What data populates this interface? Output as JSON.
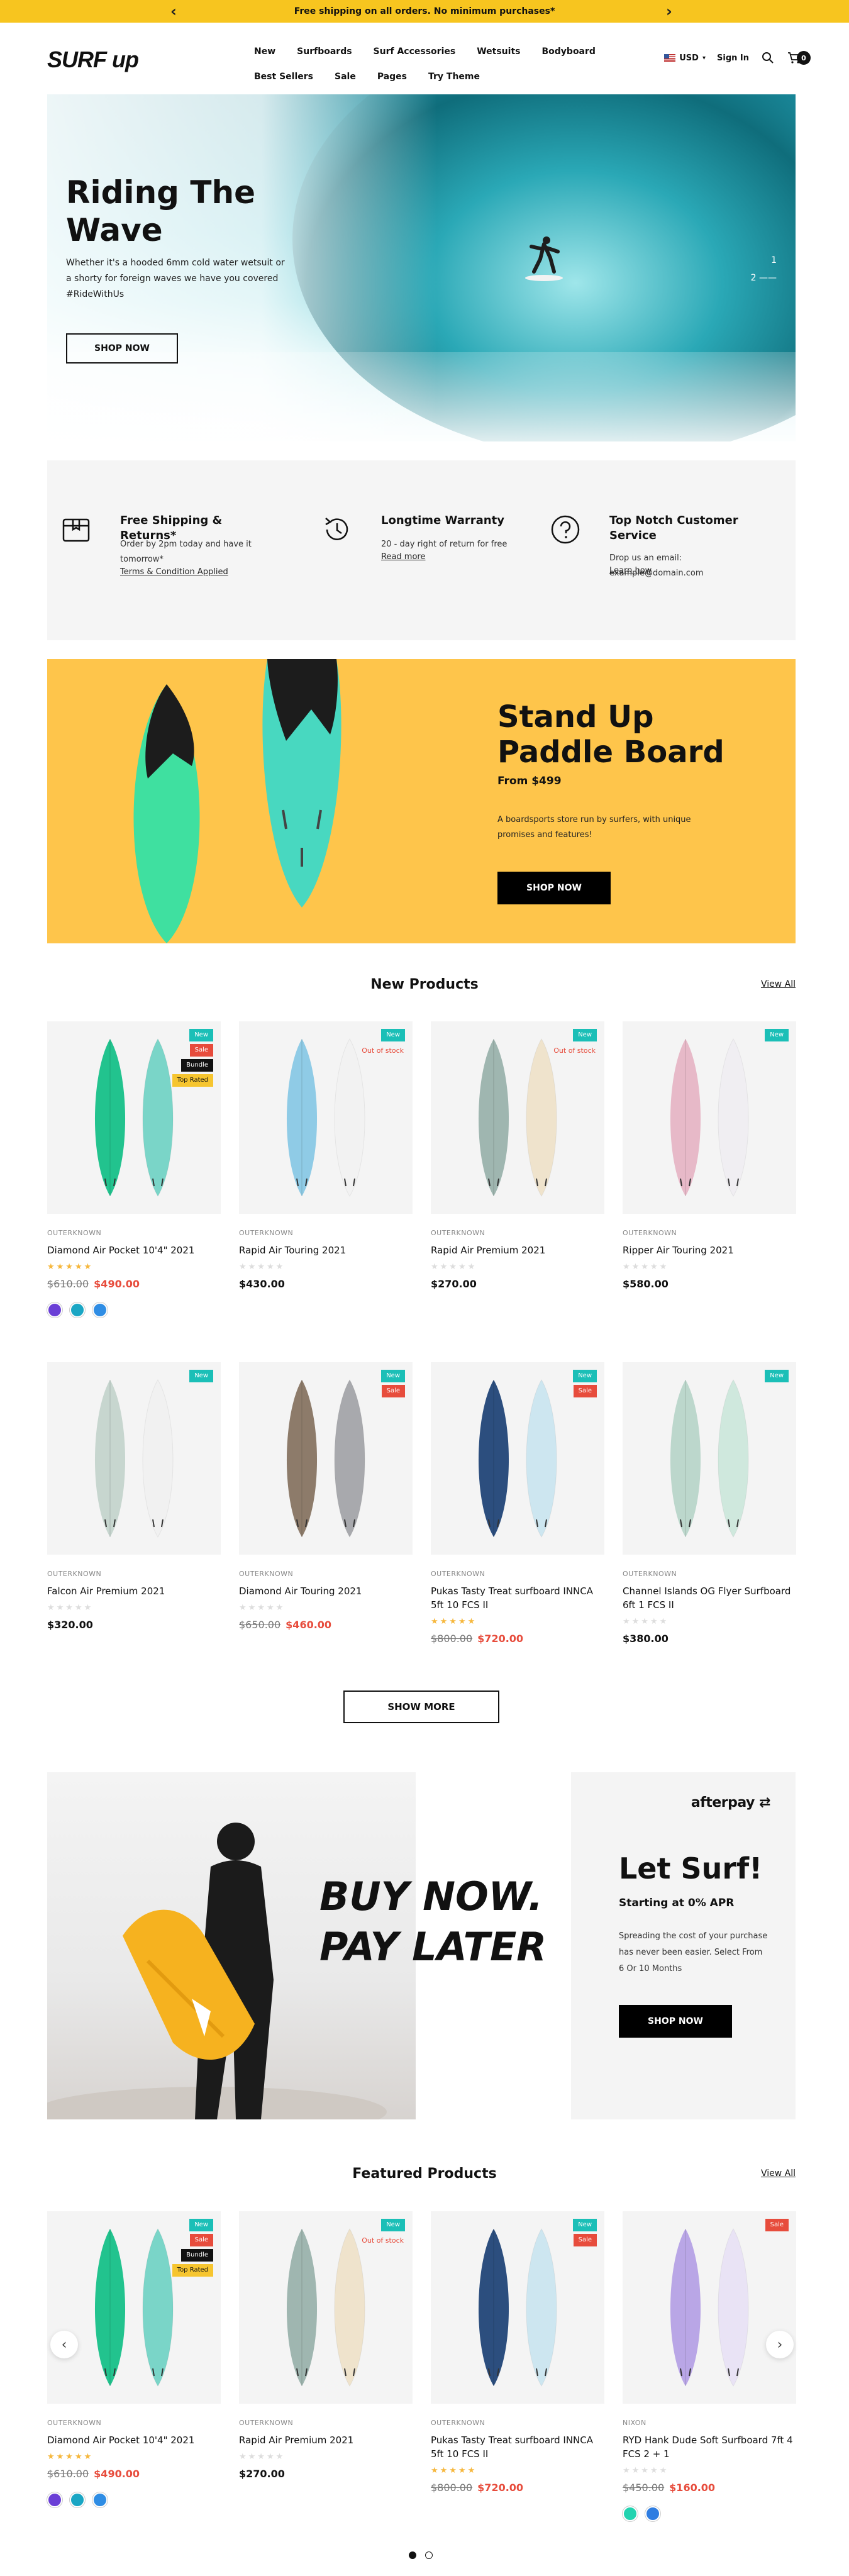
{
  "announcement": {
    "text": "Free shipping on all orders. No minimum purchases*",
    "prev_icon": "chevron-left-icon",
    "next_icon": "chevron-right-icon"
  },
  "header": {
    "logo": "SURF up",
    "nav_row1": [
      "New",
      "Surfboards",
      "Surf Accessories",
      "Wetsuits",
      "Bodyboard"
    ],
    "nav_row2": [
      "Best Sellers",
      "Sale",
      "Pages",
      "Try Theme"
    ],
    "currency": "USD",
    "sign_in": "Sign In",
    "cart_count": "0"
  },
  "hero": {
    "title": "Riding The Wave",
    "text": "Whether it's a hooded 6mm cold water wetsuit or a shorty for foreign waves we have you covered #RideWithUs",
    "button": "SHOP NOW",
    "slide_1": "1",
    "slide_2": "2"
  },
  "features": [
    {
      "icon": "box-icon",
      "title": "Free Shipping & Returns*",
      "text": "Order by 2pm today and have it tomorrow*",
      "link": "Terms & Condition Applied"
    },
    {
      "icon": "history-icon",
      "title": "Longtime Warranty",
      "text": "20 - day right of return for free",
      "link": "Read more"
    },
    {
      "icon": "help-icon",
      "title": "Top Notch Customer Service",
      "text": "Drop us an email: example@domain.com",
      "link": "Learn how"
    }
  ],
  "paddle": {
    "title": "Stand Up Paddle Board",
    "price": "From $499",
    "text": "A boardsports store run by surfers, with unique promises and features!",
    "button": "SHOP NOW"
  },
  "new_products": {
    "title": "New Products",
    "view_all": "View All",
    "items": [
      {
        "brand": "OUTERKNOWN",
        "name": "Diamond Air Pocket 10'4\" 2021",
        "rating": 5,
        "old_price": "$610.00",
        "price": "$490.00",
        "badges": [
          "New",
          "Sale",
          "Bundle",
          "Top Rated"
        ],
        "oos": "",
        "colors": [
          "#6a3fd6",
          "#1aa6c4",
          "#2f8de4"
        ],
        "board_a": "#22c38e",
        "board_b": "#7ad5c8"
      },
      {
        "brand": "OUTERKNOWN",
        "name": "Rapid Air Touring 2021",
        "rating": 0,
        "old_price": "",
        "price": "$430.00",
        "badges": [
          "New"
        ],
        "oos": "Out of stock",
        "colors": [],
        "board_a": "#8fcbe6",
        "board_b": "#f2f2f2"
      },
      {
        "brand": "OUTERKNOWN",
        "name": "Rapid Air Premium 2021",
        "rating": 0,
        "old_price": "",
        "price": "$270.00",
        "badges": [
          "New"
        ],
        "oos": "Out of stock",
        "colors": [],
        "board_a": "#9fb6b0",
        "board_b": "#efe3cc"
      },
      {
        "brand": "OUTERKNOWN",
        "name": "Ripper Air Touring 2021",
        "rating": 0,
        "old_price": "",
        "price": "$580.00",
        "badges": [
          "New"
        ],
        "oos": "",
        "colors": [],
        "board_a": "#e7b9c8",
        "board_b": "#f0eef2"
      },
      {
        "brand": "OUTERKNOWN",
        "name": "Falcon Air Premium 2021",
        "rating": 0,
        "old_price": "",
        "price": "$320.00",
        "badges": [
          "New"
        ],
        "oos": "",
        "colors": [],
        "board_a": "#c7d6cf",
        "board_b": "#f1f1f1"
      },
      {
        "brand": "OUTERKNOWN",
        "name": "Diamond Air Touring 2021",
        "rating": 0,
        "old_price": "$650.00",
        "price": "$460.00",
        "badges": [
          "New",
          "Sale"
        ],
        "oos": "",
        "colors": [],
        "board_a": "#8d7b6a",
        "board_b": "#a8a9ad"
      },
      {
        "brand": "OUTERKNOWN",
        "name": "Pukas Tasty Treat surfboard INNCA 5ft 10 FCS II",
        "rating": 5,
        "old_price": "$800.00",
        "price": "$720.00",
        "badges": [
          "New",
          "Sale"
        ],
        "oos": "",
        "colors": [],
        "board_a": "#2c4e7e",
        "board_b": "#cde6f0"
      },
      {
        "brand": "OUTERKNOWN",
        "name": "Channel Islands OG Flyer Surfboard 6ft 1 FCS II",
        "rating": 0,
        "old_price": "",
        "price": "$380.00",
        "badges": [
          "New"
        ],
        "oos": "",
        "colors": [],
        "board_a": "#bcd7cc",
        "board_b": "#cfe8dd"
      }
    ],
    "show_more": "SHOW MORE"
  },
  "afterpay": {
    "headline": "BUY NOW. PAY LATER",
    "logo": "afterpay",
    "title": "Let Surf!",
    "subtitle": "Starting at 0% APR",
    "text": "Spreading the cost of your purchase has never been easier. Select From 6 Or 10 Months",
    "button": "SHOP NOW"
  },
  "featured_products": {
    "title": "Featured Products",
    "view_all": "View All",
    "items": [
      {
        "brand": "OUTERKNOWN",
        "name": "Diamond Air Pocket 10'4\" 2021",
        "rating": 5,
        "old_price": "$610.00",
        "price": "$490.00",
        "badges": [
          "New",
          "Sale",
          "Bundle",
          "Top Rated"
        ],
        "oos": "",
        "colors": [
          "#6a3fd6",
          "#1aa6c4",
          "#2f8de4"
        ],
        "board_a": "#22c38e",
        "board_b": "#7ad5c8"
      },
      {
        "brand": "OUTERKNOWN",
        "name": "Rapid Air Premium 2021",
        "rating": 0,
        "old_price": "",
        "price": "$270.00",
        "badges": [
          "New"
        ],
        "oos": "Out of stock",
        "colors": [],
        "board_a": "#9fb6b0",
        "board_b": "#efe3cc"
      },
      {
        "brand": "OUTERKNOWN",
        "name": "Pukas Tasty Treat surfboard INNCA 5ft 10 FCS II",
        "rating": 5,
        "old_price": "$800.00",
        "price": "$720.00",
        "badges": [
          "New",
          "Sale"
        ],
        "oos": "",
        "colors": [],
        "board_a": "#2c4e7e",
        "board_b": "#cde6f0"
      },
      {
        "brand": "NIXON",
        "name": "RYD Hank Dude Soft Surfboard 7ft 4 FCS 2 + 1",
        "rating": 0,
        "old_price": "$450.00",
        "price": "$160.00",
        "badges": [
          "Sale"
        ],
        "oos": "",
        "colors": [
          "#22d3b0",
          "#2f7de1"
        ],
        "board_a": "#b9a6e6",
        "board_b": "#e9e3f5"
      }
    ],
    "prev_icon": "chevron-left-icon",
    "next_icon": "chevron-right-icon"
  },
  "colors": {
    "accent_yellow": "#f7c51f",
    "banner_yellow": "#fec54b",
    "badge_new": "#1bbfb7",
    "badge_sale": "#e74c3c"
  }
}
